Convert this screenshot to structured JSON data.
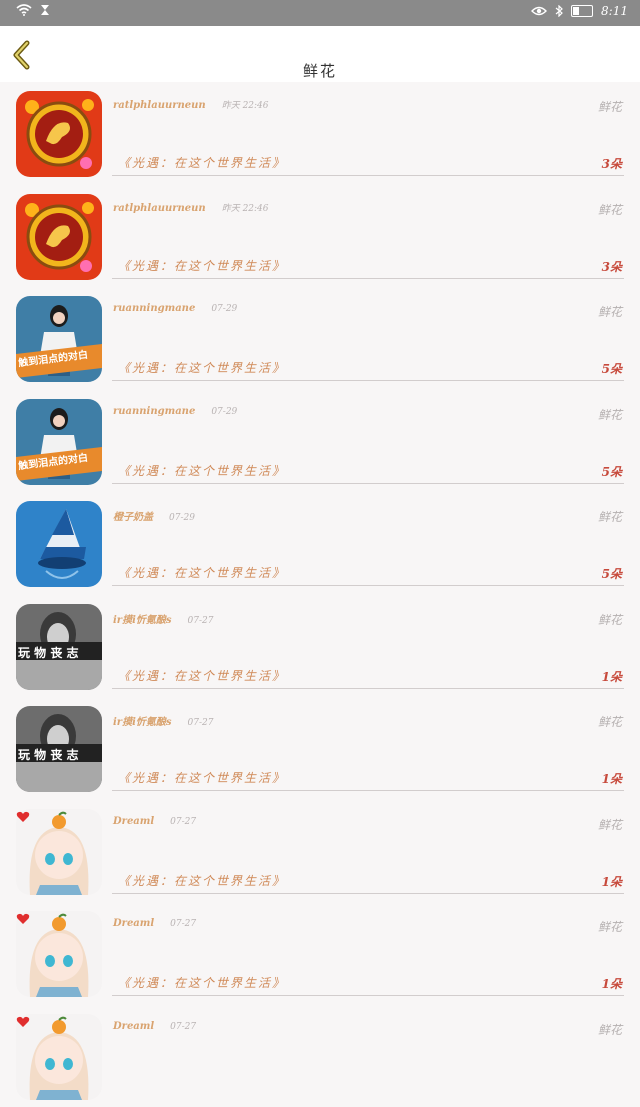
{
  "status_bar": {
    "time": "8:11"
  },
  "header": {
    "title": "鲜花"
  },
  "items": [
    {
      "name": "ratlphlauurneun",
      "time": "昨天 22:46",
      "gift_type": "鲜花",
      "game": "《光遇：在这个世界生活》",
      "count": "3朵",
      "avatar": "gold-coin"
    },
    {
      "name": "ratlphlauurneun",
      "time": "昨天 22:46",
      "gift_type": "鲜花",
      "game": "《光遇：在这个世界生活》",
      "count": "3朵",
      "avatar": "gold-coin"
    },
    {
      "name": "ruanningmane",
      "time": "07-29",
      "gift_type": "鲜花",
      "game": "《光遇：在这个世界生活》",
      "count": "5朵",
      "avatar": "girl-photo",
      "avatar_caption": "触到泪点的对白"
    },
    {
      "name": "ruanningmane",
      "time": "07-29",
      "gift_type": "鲜花",
      "game": "《光遇：在这个世界生活》",
      "count": "5朵",
      "avatar": "girl-photo",
      "avatar_caption": "触到泪点的对白"
    },
    {
      "name": "橙子奶盖",
      "time": "07-29",
      "gift_type": "鲜花",
      "game": "《光遇：在这个世界生活》",
      "count": "5朵",
      "avatar": "blue-hat"
    },
    {
      "name": "ir摸i忻氪酿s",
      "time": "07-27",
      "gift_type": "鲜花",
      "game": "《光遇：在这个世界生活》",
      "count": "1朵",
      "avatar": "bw-photo",
      "avatar_caption": "玩 物 丧 志"
    },
    {
      "name": "ir摸i忻氪酿s",
      "time": "07-27",
      "gift_type": "鲜花",
      "game": "《光遇：在这个世界生活》",
      "count": "1朵",
      "avatar": "bw-photo",
      "avatar_caption": "玩 物 丧 志"
    },
    {
      "name": "Dreaml",
      "time": "07-27",
      "gift_type": "鲜花",
      "game": "《光遇：在这个世界生活》",
      "count": "1朵",
      "avatar": "anime-girl"
    },
    {
      "name": "Dreaml",
      "time": "07-27",
      "gift_type": "鲜花",
      "game": "《光遇：在这个世界生活》",
      "count": "1朵",
      "avatar": "anime-girl"
    },
    {
      "name": "Dreaml",
      "time": "07-27",
      "gift_type": "鲜花",
      "game": "",
      "count": "",
      "avatar": "anime-girl"
    }
  ]
}
